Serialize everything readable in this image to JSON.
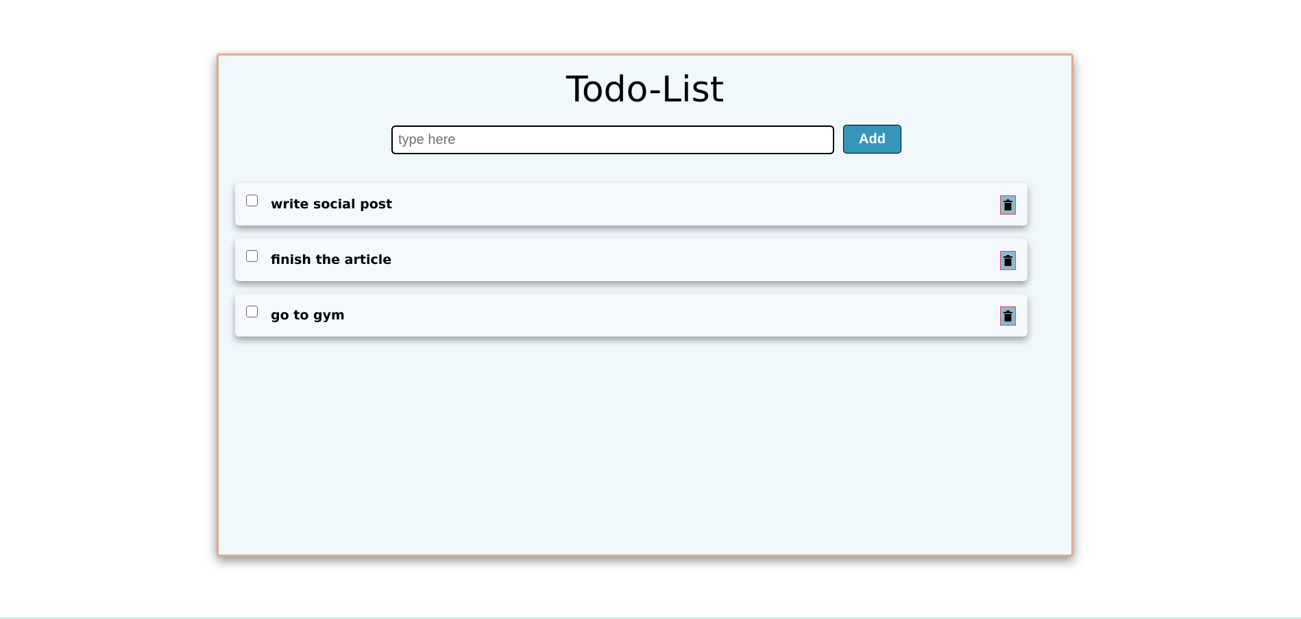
{
  "app": {
    "title": "Todo-List"
  },
  "input": {
    "placeholder": "type here",
    "value": ""
  },
  "add_button": {
    "label": "Add"
  },
  "todos": [
    {
      "text": "write social post",
      "checked": false
    },
    {
      "text": "finish the article",
      "checked": false
    },
    {
      "text": "go to gym",
      "checked": false
    }
  ],
  "icons": {
    "delete": "trash-icon"
  },
  "colors": {
    "card_background": "#f0f8fc",
    "card_border": "#e1a98f",
    "add_button": "#3497ba",
    "delete_button": "#8fb8cf",
    "delete_border": "#d94b5a"
  }
}
